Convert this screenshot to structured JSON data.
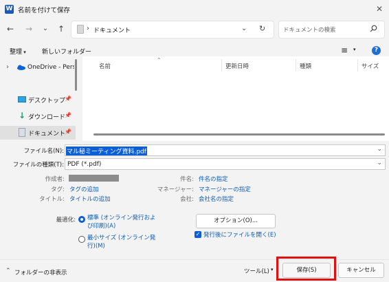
{
  "window": {
    "app_icon": "W",
    "title": "名前を付けて保存",
    "close": "✕"
  },
  "nav": {
    "back": "←",
    "forward": "→",
    "recent": "⌄",
    "up": "↑",
    "address_chevron": "›",
    "address": "ドキュメント",
    "refresh": "↻",
    "search_placeholder": "ドキュメントの検索"
  },
  "command_bar": {
    "organize": "整理",
    "new_folder": "新しいフォルダー",
    "view": "≡",
    "help": "?"
  },
  "sidebar": {
    "items": [
      {
        "label": "OneDrive - Perso",
        "icon": "cloud-icon"
      },
      {
        "label": "デスクトップ",
        "icon": "desktop-icon"
      },
      {
        "label": "ダウンロード",
        "icon": "download-icon"
      },
      {
        "label": "ドキュメント",
        "icon": "documents-icon"
      }
    ]
  },
  "file_list": {
    "columns": [
      "名前",
      "更新日時",
      "種類",
      "サイズ"
    ]
  },
  "form": {
    "filename_label": "ファイル名(N):",
    "filename_value": "マル秘ミーティング資料.pdf",
    "filetype_label": "ファイルの種類(T):",
    "filetype_value": "PDF (*.pdf)",
    "meta": {
      "author_label": "作成者:",
      "tags_label": "タグ:",
      "tags_value": "タグの追加",
      "title_label": "タイトル:",
      "title_value": "タイトルの追加",
      "subject_label": "件名:",
      "subject_value": "件名の指定",
      "manager_label": "マネージャー:",
      "manager_value": "マネージャーの指定",
      "company_label": "会社:",
      "company_value": "会社名の指定"
    },
    "optimize": {
      "label": "最適化:",
      "standard_line1": "標準 (オンライン発行およ",
      "standard_line2": "び印刷)(A)",
      "minimum_line1": "最小サイズ (オンライン発",
      "minimum_line2": "行)(M)",
      "selected": "standard"
    },
    "options_button": "オプション(O)...",
    "open_after_label": "発行後にファイルを開く(E)",
    "open_after_checked": true
  },
  "footer": {
    "hide_folders": "フォルダーの非表示",
    "tools": "ツール(L)",
    "save": "保存(S)",
    "cancel": "キャンセル"
  },
  "colors": {
    "accent": "#0a5fd8",
    "highlight": "#e01010",
    "link": "#0c5cb5"
  }
}
